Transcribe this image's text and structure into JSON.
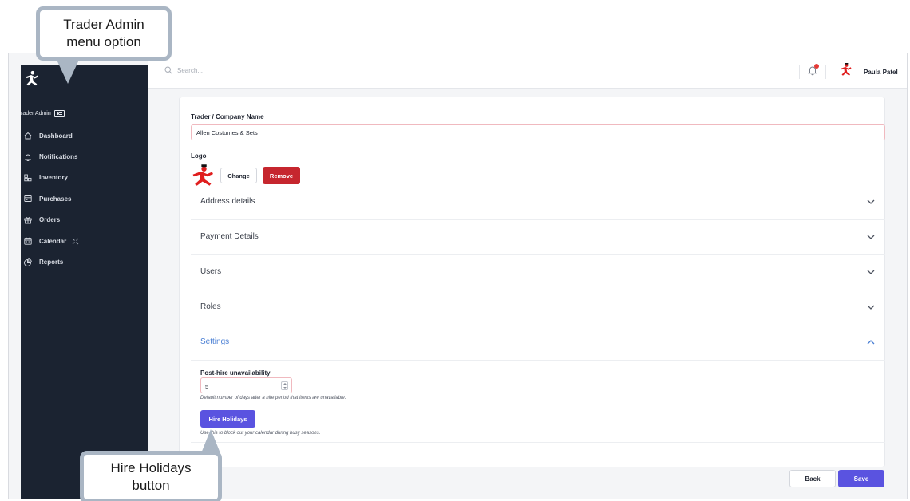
{
  "callouts": {
    "trader_admin": "Trader Admin\nmenu option",
    "hire_holidays": "Hire Holidays\nbutton"
  },
  "sidebar": {
    "logo_icon": "running-figure-logo",
    "role_label": "rader Admin",
    "role_icon": "id-card-icon",
    "items": [
      {
        "label": "Dashboard",
        "icon": "home-icon"
      },
      {
        "label": "Notifications",
        "icon": "bell-icon"
      },
      {
        "label": "Inventory",
        "icon": "boxes-icon"
      },
      {
        "label": "Purchases",
        "icon": "receipt-icon"
      },
      {
        "label": "Orders",
        "icon": "gift-icon"
      },
      {
        "label": "Calendar",
        "icon": "calendar-icon"
      },
      {
        "label": "Reports",
        "icon": "pie-chart-icon"
      }
    ]
  },
  "topbar": {
    "search_placeholder": "Search...",
    "user_name": "Paula Patel"
  },
  "form": {
    "name_label": "Trader / Company Name",
    "name_value": "Allen Costumes & Sets",
    "logo_label": "Logo",
    "change_label": "Change",
    "remove_label": "Remove"
  },
  "sections": [
    {
      "label": "Address details",
      "expanded": false
    },
    {
      "label": "Payment Details",
      "expanded": false
    },
    {
      "label": "Users",
      "expanded": false
    },
    {
      "label": "Roles",
      "expanded": false
    },
    {
      "label": "Settings",
      "expanded": true
    }
  ],
  "settings": {
    "unavailability_label": "Post-hire unavailability",
    "unavailability_value": "5",
    "unavailability_help": "Default number of days after a hire period that items are unavailable.",
    "hire_holidays_label": "Hire Holidays",
    "hire_holidays_help": "Use this to block out your calendar during busy seasons."
  },
  "footer": {
    "back_label": "Back",
    "save_label": "Save"
  },
  "colors": {
    "sidebar_bg": "#1b2331",
    "primary": "#5a53e0",
    "danger": "#c6262e",
    "accent_link": "#4a7fd4",
    "logo_red": "#e01e1e"
  }
}
